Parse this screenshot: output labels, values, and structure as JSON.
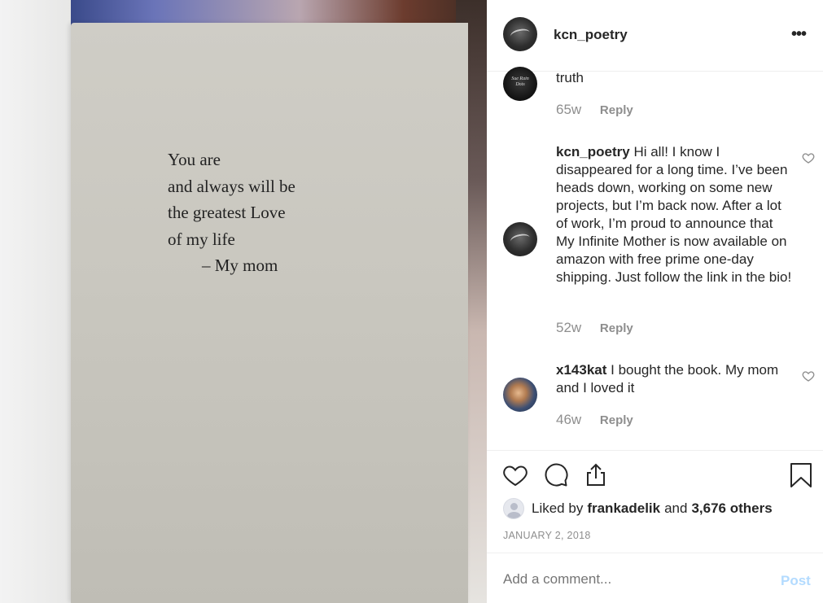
{
  "photo": {
    "poem_lines": [
      "You are",
      "and always will be",
      "the greatest Love",
      "of my life",
      "– My mom"
    ]
  },
  "header": {
    "username": "kcn_poetry",
    "more_icon": "more-horizontal-icon"
  },
  "comments": [
    {
      "username": "",
      "text": "truth",
      "time": "65w",
      "reply": "Reply"
    },
    {
      "username": "kcn_poetry",
      "text": "Hi all! I know I disappeared for a long time. I’ve been heads down, working on some new projects, but I’m back now. After a lot of work, I’m proud to announce that My Infinite Mother is now available on amazon with free prime one-day shipping. Just follow the link in the bio!",
      "time": "52w",
      "reply": "Reply"
    },
    {
      "username": "x143kat",
      "text": "I bought the book. My mom and I loved it",
      "time": "46w",
      "reply": "Reply"
    }
  ],
  "actions": {
    "liked_prefix": "Liked by",
    "liked_user": "frankadelik",
    "liked_and": "and",
    "liked_others": "3,676 others",
    "date": "JANUARY 2, 2018"
  },
  "add_comment": {
    "placeholder": "Add a comment...",
    "post_label": "Post"
  },
  "colors": {
    "text": "#262626",
    "muted": "#8e8e8e",
    "post_disabled": "#b3dbff",
    "divider": "#efefef"
  }
}
